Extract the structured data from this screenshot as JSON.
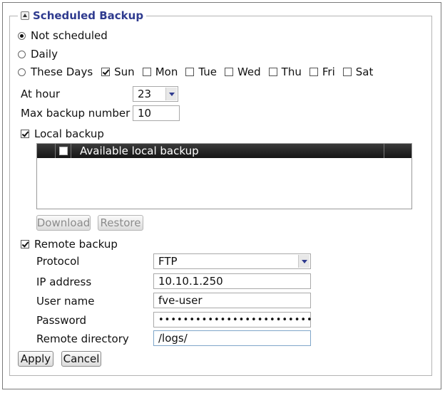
{
  "fieldset": {
    "title": "Scheduled Backup"
  },
  "schedule": {
    "not_scheduled_label": "Not scheduled",
    "daily_label": "Daily",
    "these_days_label": "These Days",
    "days": [
      {
        "label": "Sun",
        "checked": true
      },
      {
        "label": "Mon",
        "checked": false
      },
      {
        "label": "Tue",
        "checked": false
      },
      {
        "label": "Wed",
        "checked": false
      },
      {
        "label": "Thu",
        "checked": false
      },
      {
        "label": "Fri",
        "checked": false
      },
      {
        "label": "Sat",
        "checked": false
      }
    ],
    "selected": "Not scheduled"
  },
  "at_hour": {
    "label": "At hour",
    "value": "23"
  },
  "max_backup": {
    "label": "Max backup number",
    "value": "10"
  },
  "local_backup": {
    "label": "Local backup",
    "checked": true,
    "column_header": "Available local backup",
    "download_label": "Download",
    "restore_label": "Restore"
  },
  "remote_backup": {
    "label": "Remote backup",
    "checked": true,
    "protocol": {
      "label": "Protocol",
      "value": "FTP"
    },
    "ip_address": {
      "label": "IP address",
      "value": "10.10.1.250"
    },
    "user_name": {
      "label": "User name",
      "value": "fve-user"
    },
    "password": {
      "label": "Password",
      "value": "•••••••••••••••••••••••••"
    },
    "remote_directory": {
      "label": "Remote directory",
      "value": "/logs/"
    }
  },
  "actions": {
    "apply_label": "Apply",
    "cancel_label": "Cancel"
  },
  "colors": {
    "legend_title": "#2f3b8f",
    "list_header_bg": "#1e1e1e"
  }
}
